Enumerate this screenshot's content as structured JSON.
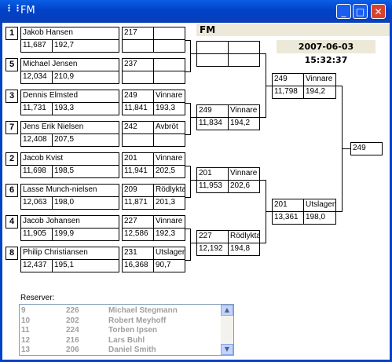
{
  "window": {
    "title": "FM",
    "icon": "grip-icon",
    "min_label": "_",
    "max_label": "□",
    "close_label": "✕"
  },
  "header": {
    "label": "FM",
    "datetime": "2007-06-03 15:32:37"
  },
  "round1": [
    {
      "seed": "1",
      "name": "Jakob Hansen",
      "v1": "11,687",
      "v2": "192,7",
      "num": "217",
      "status": "",
      "r1": "",
      "r2": ""
    },
    {
      "seed": "5",
      "name": "Michael Jensen",
      "v1": "12,034",
      "v2": "210,9",
      "num": "237",
      "status": "",
      "r1": "",
      "r2": ""
    },
    {
      "seed": "3",
      "name": "Dennis Elmsted",
      "v1": "11,731",
      "v2": "193,3",
      "num": "249",
      "status": "Vinnare",
      "r1": "11,841",
      "r2": "193,3"
    },
    {
      "seed": "7",
      "name": "Jens Erik Nielsen",
      "v1": "12,408",
      "v2": "207,5",
      "num": "242",
      "status": "Avbröt",
      "r1": "",
      "r2": ""
    },
    {
      "seed": "2",
      "name": "Jacob Kvist",
      "v1": "11,698",
      "v2": "198,5",
      "num": "201",
      "status": "Vinnare",
      "r1": "11,941",
      "r2": "202,5"
    },
    {
      "seed": "6",
      "name": "Lasse Munch-nielsen",
      "v1": "12,063",
      "v2": "198,0",
      "num": "209",
      "status": "Rödlykta",
      "r1": "11,871",
      "r2": "201,3"
    },
    {
      "seed": "4",
      "name": "Jacob Johansen",
      "v1": "11,905",
      "v2": "199,9",
      "num": "227",
      "status": "Vinnare",
      "r1": "12,586",
      "r2": "192,3"
    },
    {
      "seed": "8",
      "name": "Philip Christiansen",
      "v1": "12,437",
      "v2": "195,1",
      "num": "231",
      "status": "Utslagen",
      "r1": "16,368",
      "r2": "90,7"
    }
  ],
  "round2": [
    {
      "num": "",
      "status": "",
      "r1": "",
      "r2": ""
    },
    {
      "num": "249",
      "status": "Vinnare",
      "r1": "11,834",
      "r2": "194,2"
    },
    {
      "num": "201",
      "status": "Vinnare",
      "r1": "11,953",
      "r2": "202,6"
    },
    {
      "num": "227",
      "status": "Rödlykta",
      "r1": "12,192",
      "r2": "194,8"
    }
  ],
  "round3": [
    {
      "num": "249",
      "status": "Vinnare",
      "r1": "11,798",
      "r2": "194,2"
    },
    {
      "num": "201",
      "status": "Utslagen",
      "r1": "13,361",
      "r2": "198,0"
    }
  ],
  "final": {
    "num": "249"
  },
  "reserves": {
    "label": "Reserver:",
    "items": [
      {
        "pos": "9",
        "num": "226",
        "name": "Michael Stegmann"
      },
      {
        "pos": "10",
        "num": "202",
        "name": "Robert Meyhoff"
      },
      {
        "pos": "11",
        "num": "224",
        "name": "Torben Ipsen"
      },
      {
        "pos": "12",
        "num": "216",
        "name": "Lars Buhl"
      },
      {
        "pos": "13",
        "num": "206",
        "name": "Daniel Smith"
      }
    ],
    "scroll_up_icon": "scroll-up-icon",
    "scroll_down_icon": "scroll-down-icon"
  }
}
